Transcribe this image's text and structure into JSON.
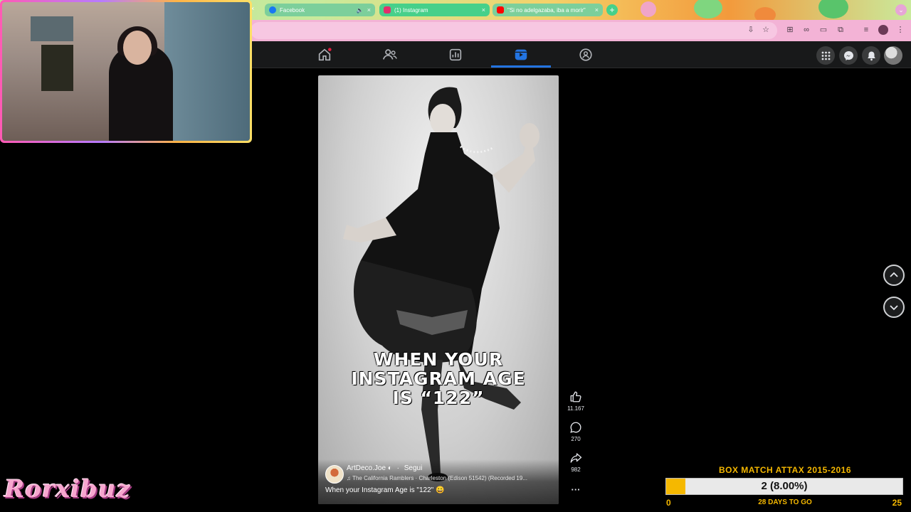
{
  "browser": {
    "tabs": [
      {
        "label": "Facebook",
        "favicon": "facebook-icon",
        "color": "#1877f2"
      },
      {
        "label": "(1) Instagram",
        "favicon": "instagram-icon",
        "color": "#e1306c",
        "active": true
      },
      {
        "label": "\"Si no adelgazaba, iba a morir\"",
        "favicon": "youtube-icon",
        "color": "#ff0000"
      }
    ],
    "new_tab_label": "+",
    "close_glyph": "×",
    "chevron_glyph": "⌄"
  },
  "fb_nav": {
    "items": [
      "home-icon",
      "friends-icon",
      "dashboard-icon",
      "video-icon",
      "groups-icon"
    ],
    "active": "video-icon",
    "right_buttons": [
      "menu-grid-icon",
      "messenger-icon",
      "notifications-icon",
      "profile-avatar"
    ],
    "accent_color": "#2374e1"
  },
  "reel": {
    "overlay_text_line1": "WHEN YOUR",
    "overlay_text_line2": "INSTAGRAM AGE",
    "overlay_text_line3": "IS “122”",
    "author": "ArtDeco.Joe",
    "verified_glyph": "◐",
    "follow_label": "Segui",
    "music": "♫ The California Ramblers · Charleston (Edison 51542) (Recorded 19...",
    "caption": "When your Instagram Age is \"122\" 😀"
  },
  "actions": {
    "likes": "11.167",
    "comments": "270",
    "shares": "982",
    "more": "···"
  },
  "stream": {
    "logo_text": "Rorxibuz"
  },
  "goal": {
    "title": "BOX MATCH ATTAX 2015-2016",
    "value_label": "2 (8.00%)",
    "progress": 0.08,
    "min": "0",
    "max": "25",
    "days": "28 DAYS TO GO",
    "color": "#f5b800"
  }
}
